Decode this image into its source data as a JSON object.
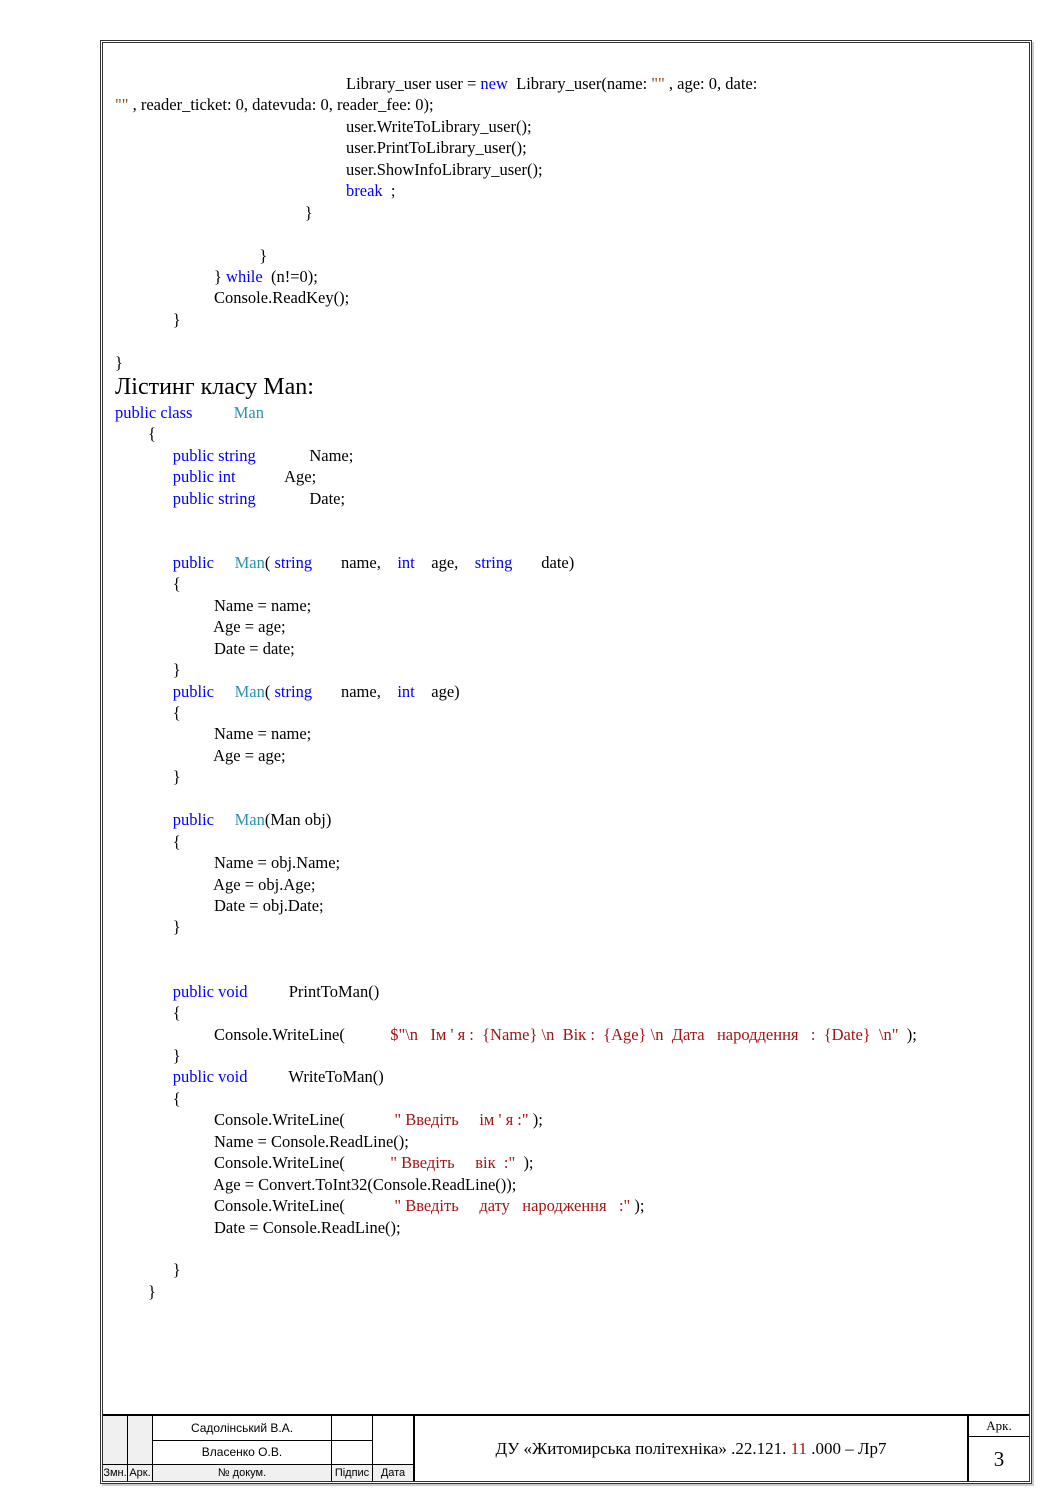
{
  "code": {
    "line1a": "                                                        Library_user user = ",
    "line1b": "new",
    "line1c": "  Library_user(name: ",
    "line1d": "\"\"",
    "line1e": " , age: 0, date: ",
    "line2a": "\"\"",
    "line2b": " , reader_ticket: 0, datevuda: 0, reader_fee: 0);",
    "line3": "                                                        user.WriteToLibrary_user();",
    "line4": "                                                        user.PrintToLibrary_user();",
    "line5": "                                                        user.ShowInfoLibrary_user();",
    "line6a": "                                                        ",
    "line6b": "break",
    "line6c": "  ;",
    "line7": "                                              }",
    "line8": "",
    "line9": "                                   }",
    "line10a": "                        } ",
    "line10b": "while",
    "line10c": "  (n!=0);",
    "line11": "                        Console.ReadKey();",
    "line12": "              }",
    "line13": "",
    "line14": "}",
    "heading": "Лістинг класу Man:",
    "m1a": "public class",
    "m1b": "          Man",
    "m2": "        {",
    "m3a": "              public string",
    "m3b": "             Name;",
    "m4a": "              public int",
    "m4b": "            Age;",
    "m5a": "              public string",
    "m5b": "             Date;",
    "m6": "",
    "m7": "",
    "m8a": "              public",
    "m8b": "     Man",
    "m8c": "( ",
    "m8d": "string",
    "m8e": "       name, ",
    "m8f": "   int",
    "m8g": "    age,    ",
    "m8h": "string",
    "m8i": "       date)",
    "m9": "              {",
    "m10": "                        Name = name;",
    "m11": "                        Age = age;",
    "m12": "                        Date = date;",
    "m13": "              }",
    "m14a": "              public",
    "m14b": "     Man",
    "m14c": "( ",
    "m14d": "string",
    "m14e": "       name, ",
    "m14f": "   int",
    "m14g": "    age)",
    "m15": "              {",
    "m16": "                        Name = name;",
    "m17": "                        Age = age;",
    "m18": "              }",
    "m19": "",
    "m20a": "              public",
    "m20b": "     Man",
    "m20c": "(Man obj)",
    "m21": "              {",
    "m22": "                        Name = obj.Name;",
    "m23": "                        Age = obj.Age;",
    "m24": "                        Date = obj.Date;",
    "m25": "              }",
    "m26": "",
    "m27": "",
    "m28a": "              public void",
    "m28b": "          PrintToMan()",
    "m29": "              {",
    "m30a": "                        Console.WriteLine(",
    "m30b": "           $\"",
    "m30c": "\\n   Iм ' я :  {Name} ",
    "m30d": "\\n  Вік :  {Age} ",
    "m30e": "\\n  Дата   народдення   :  {Date}  ",
    "m30f": "\\n\"",
    "m30g": "  );",
    "m31": "              }",
    "m32a": "              public void",
    "m32b": "          WriteToMan()",
    "m33": "              {",
    "m34a": "                        Console.WriteLine(",
    "m34b": "            \" Введіть     ім ' я :\"",
    "m34c": " );",
    "m35": "                        Name = Console.ReadLine();",
    "m36a": "                        Console.WriteLine(",
    "m36b": "           \" Введіть     вік  :\"",
    "m36c": "  );",
    "m37": "                        Age = Convert.ToInt32(Console.ReadLine());",
    "m38a": "                        Console.WriteLine(",
    "m38b": "            \" Введіть     дату   народження   :\"",
    "m38c": " );",
    "m39": "                        Date = Console.ReadLine();",
    "m40": "",
    "m41": "              }",
    "m42": "        }"
  },
  "title_block": {
    "name1": "Садолінський В.А.",
    "name2": "Власенко О.В.",
    "zmn": "Змн.",
    "ark_left": "Арк.",
    "nom_docum": "№ докум.",
    "pidpis": "Підпис",
    "data": "Дата",
    "center_a": "ДУ «Житомирська політехніка»      .22.121. ",
    "center_b": "11",
    "center_c": " .000  –  Лр7",
    "ark_right": "Арк.",
    "page_num": "3"
  }
}
